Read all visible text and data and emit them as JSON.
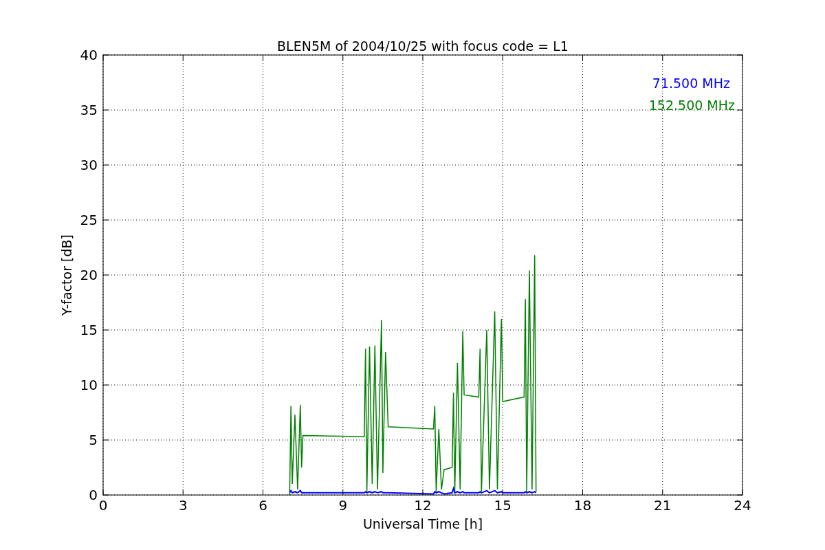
{
  "figure": {
    "chart_data": {
      "type": "line",
      "title": "BLEN5M of 2004/10/25 with focus code = L1",
      "xlabel": "Universal Time [h]",
      "ylabel": "Y-factor [dB]",
      "xlim": [
        0,
        24
      ],
      "ylim": [
        0,
        40
      ],
      "xticks": [
        0,
        3,
        6,
        9,
        12,
        15,
        18,
        21,
        24
      ],
      "yticks": [
        0,
        5,
        10,
        15,
        20,
        25,
        30,
        35,
        40
      ],
      "grid": true,
      "x": [
        7.0,
        7.05,
        7.1,
        7.2,
        7.3,
        7.4,
        7.45,
        7.5,
        9.8,
        9.85,
        9.9,
        10.0,
        10.1,
        10.2,
        10.3,
        10.45,
        10.5,
        10.6,
        10.7,
        12.4,
        12.45,
        12.5,
        12.6,
        12.7,
        12.8,
        13.1,
        13.15,
        13.2,
        13.3,
        13.4,
        13.5,
        13.55,
        14.1,
        14.15,
        14.2,
        14.4,
        14.5,
        14.7,
        14.8,
        14.95,
        15.0,
        15.8,
        15.85,
        15.9,
        16.0,
        16.1,
        16.2,
        16.25
      ],
      "series": [
        {
          "name": "71.500 MHz",
          "color": "#0000ff",
          "values": [
            0.2,
            0.4,
            0.2,
            0.3,
            0.2,
            0.4,
            0.2,
            0.2,
            0.2,
            0.3,
            0.2,
            0.3,
            0.2,
            0.3,
            0.2,
            0.3,
            0.2,
            0.2,
            0.2,
            0.1,
            0.3,
            0.2,
            0.3,
            0.2,
            0.1,
            0.2,
            0.6,
            0.2,
            0.3,
            0.2,
            0.3,
            0.2,
            0.2,
            0.3,
            0.2,
            0.4,
            0.2,
            0.4,
            0.2,
            0.3,
            0.2,
            0.2,
            0.3,
            0.2,
            0.3,
            0.2,
            0.3,
            0.2
          ]
        },
        {
          "name": "152.500 MHz",
          "color": "#008000",
          "values": [
            0,
            8.1,
            1,
            7.3,
            0.5,
            8.2,
            2.5,
            5.4,
            5.3,
            13.3,
            0.3,
            13.5,
            1,
            13.6,
            0.5,
            15.9,
            2,
            13,
            6.2,
            6.0,
            8.1,
            0.3,
            6,
            0.5,
            2.3,
            2.5,
            9.3,
            0.3,
            12,
            0.5,
            14.9,
            9.1,
            8.9,
            13.3,
            0.3,
            15,
            0.5,
            16.7,
            0.5,
            16,
            8.5,
            8.9,
            17.8,
            0.3,
            20.4,
            0.5,
            21.8,
            0.3
          ]
        }
      ]
    }
  }
}
